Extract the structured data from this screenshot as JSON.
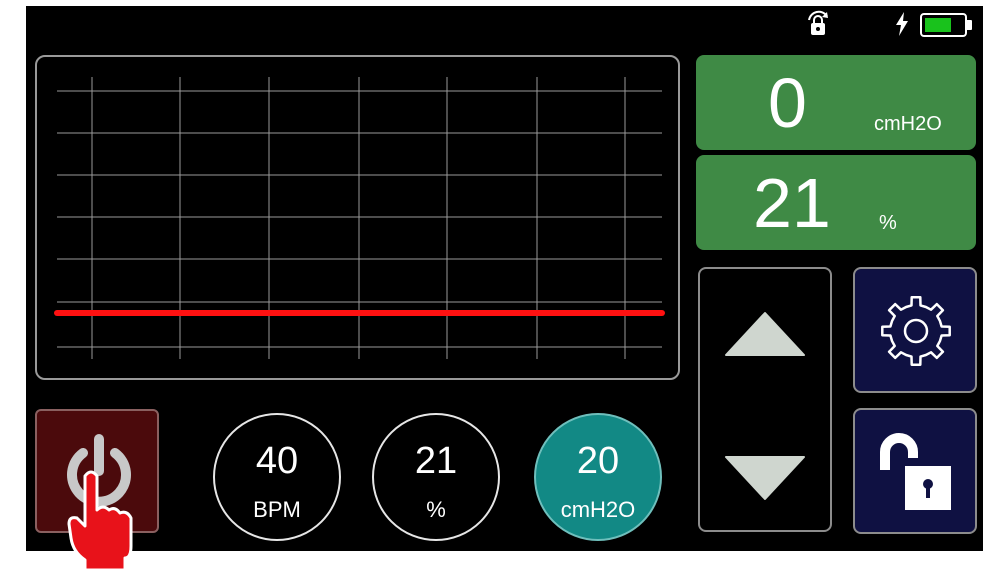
{
  "status_bar": {
    "lock_rotate_icon": "screen-rotation-lock-icon",
    "charging_icon": "lightning-bolt-icon",
    "battery_icon": "battery-icon",
    "battery_color": "#19c21c"
  },
  "waveform": {
    "line_color": "#ff1111",
    "grid_color": "#9a9a9a"
  },
  "readouts": {
    "pressure": {
      "value": "0",
      "unit": "cmH2O",
      "color": "#3f8a45"
    },
    "oxygen": {
      "value": "21",
      "unit": "%",
      "color": "#3f8a45"
    }
  },
  "controls": {
    "up_icon": "triangle-up-icon",
    "down_icon": "triangle-down-icon",
    "settings_icon": "gear-icon",
    "unlock_icon": "unlocked-padlock-icon",
    "power_icon": "power-icon",
    "power_color": "#4b0a0c",
    "nav_color": "#0f1142"
  },
  "settings": [
    {
      "value": "40",
      "label": "BPM",
      "active": false
    },
    {
      "value": "21",
      "label": "%",
      "active": false
    },
    {
      "value": "20",
      "label": "cmH2O",
      "active": true
    }
  ],
  "active_color": "#128985"
}
